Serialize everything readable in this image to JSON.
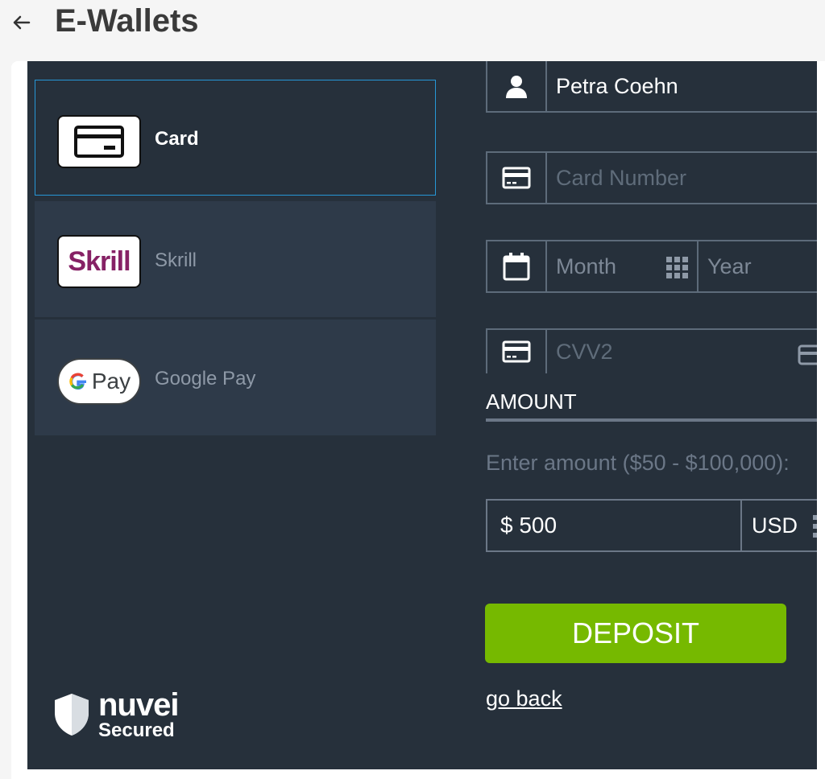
{
  "header": {
    "title": "E-Wallets"
  },
  "methods": [
    {
      "label": "Card",
      "selected": true,
      "icon": "credit-card-icon"
    },
    {
      "label": "Skrill",
      "selected": false,
      "logo_text": "Skrill",
      "brand_color": "#862165"
    },
    {
      "label": "Google Pay",
      "selected": false,
      "logo_text": "Pay"
    }
  ],
  "form": {
    "name_value": "Petra Coehn",
    "card_number_placeholder": "Card Number",
    "month_placeholder": "Month",
    "year_placeholder": "Year",
    "cvv_placeholder": "CVV2"
  },
  "amount": {
    "heading": "AMOUNT",
    "hint": "Enter amount ($50 - $100,000):",
    "value": "$ 500",
    "currency": "USD"
  },
  "actions": {
    "deposit_label": "DEPOSIT",
    "go_back_label": "go back"
  },
  "footer": {
    "brand_name": "nuvei",
    "brand_tagline": "Secured"
  },
  "colors": {
    "panel_bg": "#26303b",
    "accent_green": "#76b900",
    "selected_border": "#2696d6"
  }
}
